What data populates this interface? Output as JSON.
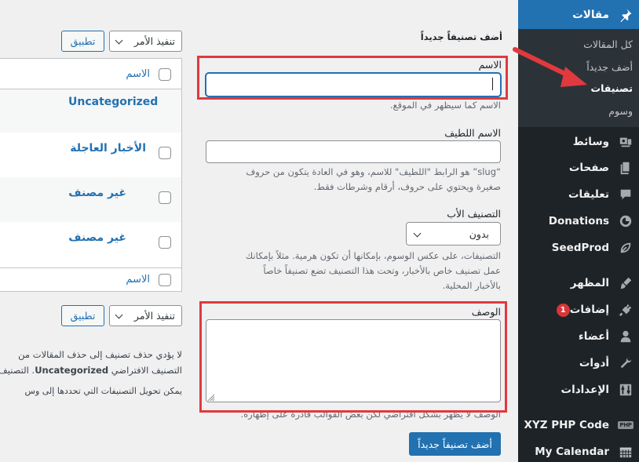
{
  "sidebar": {
    "posts_label": "مقالات",
    "submenu": {
      "all_posts": "كل المقالات",
      "add_new": "أضف جديداً",
      "categories": "تصنيفات",
      "tags": "وسوم"
    },
    "items": [
      {
        "label": "وسائط",
        "icon": "media-icon"
      },
      {
        "label": "صفحات",
        "icon": "pages-icon"
      },
      {
        "label": "تعليقات",
        "icon": "comments-icon"
      },
      {
        "label": "Donations",
        "icon": "donations-icon"
      },
      {
        "label": "SeedProd",
        "icon": "seedprod-icon"
      },
      {
        "label": "المظهر",
        "icon": "appearance-icon"
      },
      {
        "label": "إضافات",
        "icon": "plugins-icon",
        "badge": "1"
      },
      {
        "label": "أعضاء",
        "icon": "users-icon"
      },
      {
        "label": "أدوات",
        "icon": "tools-icon"
      },
      {
        "label": "الإعدادات",
        "icon": "settings-icon"
      },
      {
        "label": "XYZ PHP Code",
        "icon": "php-icon",
        "icon_text": "PHP"
      },
      {
        "label": "My Calendar",
        "icon": "calendar-icon"
      }
    ],
    "colors": {
      "bg": "#1d2327",
      "active": "#2271b1",
      "submenu_bg": "#2c3338"
    }
  },
  "form": {
    "heading": "أضف تصنيفاً جديداً",
    "name_label": "الاسم",
    "name_value": "",
    "name_desc": "الاسم كما سيظهر في الموقع.",
    "slug_label": "الاسم اللطيف",
    "slug_value": "",
    "slug_desc_line1": "“slug” هو الرابط \"اللطيف\" للاسم، وهو في العادة يتكون من حروف",
    "slug_desc_line2": "صغيرة ويحتوي على حروف، أرقام وشرطات فقط.",
    "parent_label": "التصنيف الأب",
    "parent_selected": "بدون",
    "parent_desc_line1": "التصنيفات، على عكس الوسوم، بإمكانها أن تكون هرمية. مثلاً بإمكانك",
    "parent_desc_line2": "عمل تصنيف خاص بالأخبار، وتحت هذا التصنيف تضع تصنيفاً خاصاً",
    "parent_desc_line3": "بالأخبار المحلية.",
    "description_label": "الوصف",
    "description_value": "",
    "description_desc": "الوصف لا يظهر بشكل افتراضي لكن بعض القوالب قادرة على إظهاره.",
    "submit_label": "أضف تصنيفاً جديداً",
    "highlight_color": "#e0393e"
  },
  "table": {
    "bulk_action": "تنفيذ الأمر",
    "apply": "تطبيق",
    "header_name": "الاسم",
    "footer_name": "الاسم",
    "rows": [
      {
        "name": "Uncategorized"
      },
      {
        "name": "الأخبار العاجلة"
      },
      {
        "name": "غير مصنف"
      },
      {
        "name": "غير مصنف"
      }
    ],
    "note_line1": "لا يؤدي حذف تصنيف إلى حذف المقالات من",
    "note_line2_bold": "Uncategorized",
    "note_line2_pre": "التصنيف الافتراضي",
    "note_line2_post": ". التصنيف",
    "note_line3": "يمكن تحويل التصنيفات التي تحددها إلى وس"
  }
}
